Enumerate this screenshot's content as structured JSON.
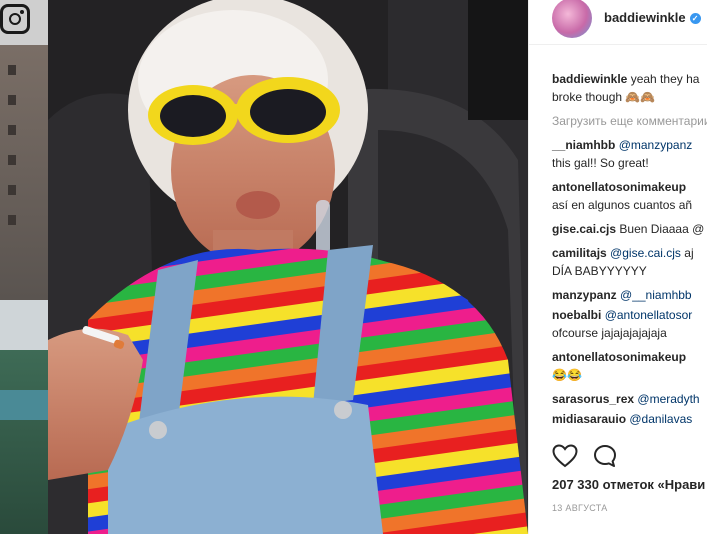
{
  "post": {
    "username": "baddiewinkle",
    "verified_icon": "verified-badge-icon",
    "caption_user": "baddiewinkle",
    "caption_text": "yeah they ha",
    "caption_line2": "broke though",
    "caption_emoji": "🙈🙈"
  },
  "comments": {
    "load_more": "Загрузить еще комментарии",
    "items": [
      {
        "user": "__niamhbb",
        "mention": "@manzypanz",
        "text": "",
        "line2": "this gal!! So great!"
      },
      {
        "user": "antonellatosonimakeup",
        "mention": "",
        "text": "",
        "line2": "así en algunos cuantos añ"
      },
      {
        "user": "gise.cai.cjs",
        "mention": "",
        "text": "Buen Diaaaa @",
        "line2": ""
      },
      {
        "user": "camilitajs",
        "mention": "@gise.cai.cjs",
        "text": "aj",
        "line2": "DÍA BABYYYYYY"
      },
      {
        "user": "manzypanz",
        "mention": "@__niamhbb",
        "text": "",
        "line2": ""
      },
      {
        "user": "noebalbi",
        "mention": "@antonellatosor",
        "text": "",
        "line2": "ofcourse jajajajajajaja"
      },
      {
        "user": "antonellatosonimakeup",
        "mention": "",
        "text": "",
        "line2": "😂😂"
      },
      {
        "user": "sarasorus_rex",
        "mention": "@meradyth",
        "text": "",
        "line2": ""
      },
      {
        "user": "midiasarauio",
        "mention": "@danilavas",
        "text": "",
        "line2": ""
      }
    ]
  },
  "actions": {
    "like_icon": "heart-icon",
    "comment_icon": "comment-bubble-icon"
  },
  "likes_text": "207 330 отметок «Нрави",
  "date_text": "13 АВГУСТА",
  "colors": {
    "mention": "#003569",
    "text": "#262626",
    "muted": "#999999",
    "verified": "#3897f0"
  }
}
